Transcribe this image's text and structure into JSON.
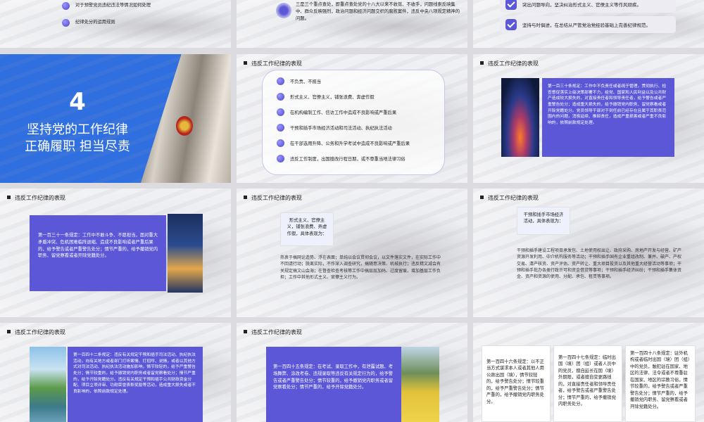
{
  "top_row": {
    "left_items": [
      "对于预警党员违纪违法等情况如何处理",
      "纪律处分的运用规则"
    ],
    "center_text": "三是三个重点查处，即重点查处党的十八大以来不收敛、不收手，问题线索反映集中、群众反映强烈，政治问题和经济问题交织的腐败案件，违反中央八项规定精神的问题。",
    "right_items": [
      "突出问题导向，坚决纠治形式主义、官僚主义等作风顽疾。",
      "坚持与时俱进，在总结从严管党治党经验基础上完善纪律规范。"
    ]
  },
  "section_slide": {
    "number": "4",
    "title_line1": "坚持党的工作纪律",
    "title_line2": "正确履职 担当尽责"
  },
  "slide_list": {
    "title": "违反工作纪律的表现",
    "items": [
      "不负责、不担当",
      "形式主义、官僚主义，铺张浪费、奔虚作假",
      "在机构编制工作、信访工作中造成不良影响或严重后果",
      "干预和插手市场经济活动和司法活动、执纪执法活动",
      "在干部选用升降、公务和升学考试中造成不良影响或严重后果",
      "违反工作制度，出国擅改行程日期，或不尊重当地法律习俗"
    ]
  },
  "slide_130": {
    "title": "违反工作纪律的表现",
    "text": "第一百三十条规定：工作中不负责任或者疏于管理，贯彻执行、检查督促落实上级决策部署不力，给党、国家和人民利益以及公共财产造成较大损失的，对直接责任者和领导责任者，给予警告或者严重警告处分；造成重大损失的，给予撤销党内职务、留党察看或者开除党籍处分。党员领导干部对于到任前已经存在且属于其职责范围内的问题，消极延续、推卸责任，造成严重损害或者严重不良影响的，依照前款规定处理。"
  },
  "slide_131": {
    "title": "违反工作纪律的表现",
    "text": "第一百三十一条规定：工作中不敢斗争、不愿担当，面对重大矛盾冲突、危机困难临阵退缩、造成不良影响或者严重后果的，给予警告或者严重警告处分；情节严重的，给予撤销党内职务、留党察看或者开除党籍处分。"
  },
  "slide_formalism": {
    "title": "违反工作纪律的表现",
    "callout": "形式主义、官僚主义，铺张浪费、弄虚作假，具体表现为：",
    "text": "热衷于搞网论造势、浮在表面；单纯以会议贯彻会议，以文件落实文件，在实际工作中不回请行动；脱离实际，不作深入调查研究，搞随意决策、机械执行；违反精文减会有关规定搞文山会海；在督查检查考核等工作中搞层层加码、过度留痕，增加基层工作负担；工作中其他形式主义、官僚主义行为。"
  },
  "slide_market": {
    "title": "违反工作纪律的表现",
    "callout": "干预和插手市场经济活动，具体表现为：",
    "text": "干预和插手建设工程项目承发包、土地使用权出让、政府采购、房地产开发与经营、矿产资源开发利用、中介机构服务等活动；干预和插手国有企业重组改制、兼并、破产、产权交易、清产核资、资产评估、资产转让、重大项目投资以及其他重大经营活动等事项；干预和插手批办各类行政许可和资金借贷等事项；干预和插手经济纠纷；干预和插手集体资金、资产和资源的使用、分配、承包、租赁等事项。"
  },
  "slide_142": {
    "title": "违反工作纪律的表现",
    "text": "第一百四十二条规定：违反有关规定干预和插手司法活动、执纪执法活动，向有关地方或者部门打听案情、打招呼、说情，或者以其他方式对司法活动、执纪执法活动施加影响，情节较轻的，给予严重警告处分；情节较重的，给予撤销党内职务或者留党察看处分；情节严重的，给予开除党籍处分。违反有关规定干预和插手公共财政资金分配、项目立项评审、功勋荣誉表彰奖励等活动，造成重大损失或者不良影响的，依照前款规定处理。"
  },
  "slide_145": {
    "title": "违反工作纪律的表现",
    "text": "第一百四十五条规定：在考试、录取工作中，有泄露试题、考场舞弊、涂改考卷、违规录取等违反有关规定行为的，给予警告或者严重警告处分；情节较重的，给予撤销党内职务或者留党察看处分；情节严重的，给予开除党籍处分。"
  },
  "slide_146_148": {
    "col1": "第一百四十六条规定：以不正当方式谋求本人或者其他人用公款出国（境），情节较轻的，给予警告处分；情节较重的，给予严重警告处分；情节严重的，给予撤销党内职务处分。",
    "col2": "第一百四十七条规定：临时出国（境）团（组）或者人员中的党员，擅自延长在国（境）外期限，或者擅自变更路线的，对直接责任者和领导责任者，给予警告或者严重警告处分；情节严重的，给予撤销党内职务处分。",
    "col3": "第一百四十八条规定：驻外机构或者临时出国（境）团（组）中的党员，触犯驻在国家、地区的法律、法令或者不尊重驻在国家、地区的宗教习俗，情节较重的，给予警告或者严重警告处分；情节严重的，给予撤销党内职务、留党察看或者开除党籍处分。"
  },
  "colors": {
    "accent": "#5b57d6",
    "blue": "#2f6fe0"
  }
}
